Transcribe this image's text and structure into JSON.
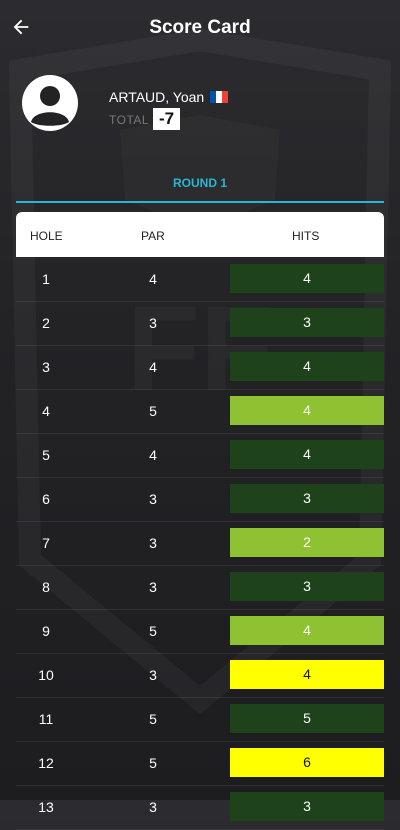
{
  "header": {
    "title": "Score Card"
  },
  "player": {
    "name": "ARTAUD, Yoan",
    "flag_colors": [
      "#0055a4",
      "#ffffff",
      "#ef4135"
    ],
    "total_label": "TOTAL",
    "total_value": "-7"
  },
  "round": {
    "label": "ROUND 1"
  },
  "table": {
    "headers": {
      "hole": "HOLE",
      "par": "PAR",
      "hits": "HITS"
    },
    "rows": [
      {
        "hole": "1",
        "par": "4",
        "hits": "4",
        "color": "#1e4219",
        "text": "#ffffff"
      },
      {
        "hole": "2",
        "par": "3",
        "hits": "3",
        "color": "#1e4219",
        "text": "#ffffff"
      },
      {
        "hole": "3",
        "par": "4",
        "hits": "4",
        "color": "#1e4219",
        "text": "#ffffff"
      },
      {
        "hole": "4",
        "par": "5",
        "hits": "4",
        "color": "#8fc232",
        "text": "#ffffff"
      },
      {
        "hole": "5",
        "par": "4",
        "hits": "4",
        "color": "#1e4219",
        "text": "#ffffff"
      },
      {
        "hole": "6",
        "par": "3",
        "hits": "3",
        "color": "#1e4219",
        "text": "#ffffff"
      },
      {
        "hole": "7",
        "par": "3",
        "hits": "2",
        "color": "#8fc232",
        "text": "#ffffff"
      },
      {
        "hole": "8",
        "par": "3",
        "hits": "3",
        "color": "#1e4219",
        "text": "#ffffff"
      },
      {
        "hole": "9",
        "par": "5",
        "hits": "4",
        "color": "#8fc232",
        "text": "#ffffff"
      },
      {
        "hole": "10",
        "par": "3",
        "hits": "4",
        "color": "#ffff00",
        "text": "#111111"
      },
      {
        "hole": "11",
        "par": "5",
        "hits": "5",
        "color": "#1e4219",
        "text": "#ffffff"
      },
      {
        "hole": "12",
        "par": "5",
        "hits": "6",
        "color": "#ffff00",
        "text": "#111111"
      },
      {
        "hole": "13",
        "par": "3",
        "hits": "3",
        "color": "#1e4219",
        "text": "#ffffff"
      }
    ]
  }
}
